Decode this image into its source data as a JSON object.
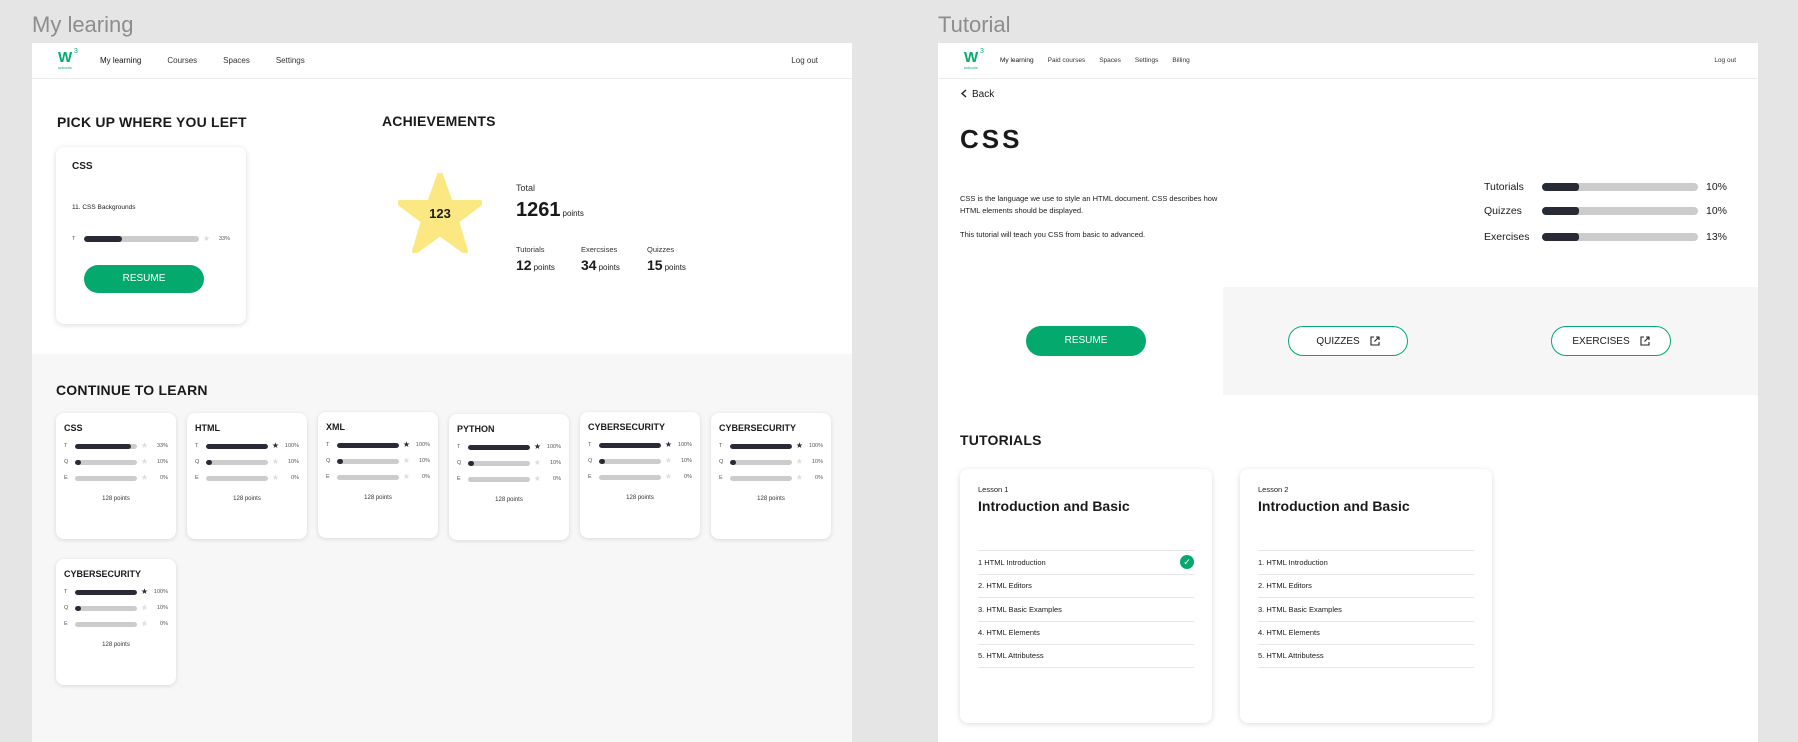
{
  "left": {
    "frame_label": "My learing",
    "nav": {
      "items": [
        "My learning",
        "Courses",
        "Spaces",
        "Settings"
      ],
      "logout": "Log out"
    },
    "pick_up": {
      "heading": "PICK UP WHERE YOU LEFT",
      "course": "CSS",
      "lesson": "11. CSS Backgrounds",
      "row_label": "T",
      "progress": 0.33,
      "percent": "33%",
      "resume": "RESUME"
    },
    "achievements": {
      "heading": "ACHIEVEMENTS",
      "star_value": "123",
      "total_label": "Total",
      "total_value": "1261",
      "points_word": "points",
      "tutorials_label": "Tutorials",
      "tutorials_value": "12",
      "exercises_label": "Exercsises",
      "exercises_value": "34",
      "quizzes_label": "Quizzes",
      "quizzes_value": "15"
    },
    "continue": {
      "heading": "CONTINUE TO LEARN",
      "cards": [
        {
          "title": "CSS",
          "rows": [
            {
              "l": "T",
              "p": 0.9,
              "s": false,
              "v": "33%"
            },
            {
              "l": "Q",
              "p": 0.1,
              "s": false,
              "v": "10%"
            },
            {
              "l": "E",
              "p": 0,
              "s": false,
              "v": "0%"
            }
          ],
          "points": "128 points"
        },
        {
          "title": "HTML",
          "rows": [
            {
              "l": "T",
              "p": 1,
              "s": true,
              "v": "100%"
            },
            {
              "l": "Q",
              "p": 0.1,
              "s": false,
              "v": "10%"
            },
            {
              "l": "E",
              "p": 0,
              "s": false,
              "v": "0%"
            }
          ],
          "points": "128 points"
        },
        {
          "title": "XML",
          "rows": [
            {
              "l": "T",
              "p": 1,
              "s": true,
              "v": "100%"
            },
            {
              "l": "Q",
              "p": 0.1,
              "s": false,
              "v": "10%"
            },
            {
              "l": "E",
              "p": 0,
              "s": false,
              "v": "0%"
            }
          ],
          "points": "128 points"
        },
        {
          "title": "PYTHON",
          "rows": [
            {
              "l": "T",
              "p": 1,
              "s": true,
              "v": "100%"
            },
            {
              "l": "Q",
              "p": 0.1,
              "s": false,
              "v": "10%"
            },
            {
              "l": "E",
              "p": 0,
              "s": false,
              "v": "0%"
            }
          ],
          "points": "128 points"
        },
        {
          "title": "CYBERSECURITY",
          "rows": [
            {
              "l": "T",
              "p": 1,
              "s": true,
              "v": "100%"
            },
            {
              "l": "Q",
              "p": 0.1,
              "s": false,
              "v": "10%"
            },
            {
              "l": "E",
              "p": 0,
              "s": false,
              "v": "0%"
            }
          ],
          "points": "128 points"
        },
        {
          "title": "CYBERSECURITY",
          "rows": [
            {
              "l": "T",
              "p": 1,
              "s": true,
              "v": "100%"
            },
            {
              "l": "Q",
              "p": 0.1,
              "s": false,
              "v": "10%"
            },
            {
              "l": "E",
              "p": 0,
              "s": false,
              "v": "0%"
            }
          ],
          "points": "128 points"
        },
        {
          "title": "CYBERSECURITY",
          "rows": [
            {
              "l": "T",
              "p": 1,
              "s": true,
              "v": "100%"
            },
            {
              "l": "Q",
              "p": 0.1,
              "s": false,
              "v": "10%"
            },
            {
              "l": "E",
              "p": 0,
              "s": false,
              "v": "0%"
            }
          ],
          "points": "128 points"
        }
      ]
    }
  },
  "right": {
    "frame_label": "Tutorial",
    "nav": {
      "items": [
        "My learning",
        "Paid courses",
        "Spaces",
        "Settings",
        "Billing"
      ],
      "logout": "Log out"
    },
    "back": "Back",
    "title": "CSS",
    "desc1": "CSS is the language we use to style an HTML document. CSS describes how HTML elements should be displayed.",
    "desc2": "This tutorial will teach you CSS from basic to advanced.",
    "stats": [
      {
        "label": "Tutorials",
        "progress": 0.24,
        "value": "10%"
      },
      {
        "label": "Quizzes",
        "progress": 0.24,
        "value": "10%"
      },
      {
        "label": "Exercises",
        "progress": 0.24,
        "value": "13%"
      }
    ],
    "buttons": {
      "resume": "RESUME",
      "quizzes": "QUIZZES",
      "exercises": "EXERCISES"
    },
    "tutorials_heading": "TUTORIALS",
    "lessons": [
      {
        "lesson": "Lesson 1",
        "title": "Introduction and Basic",
        "items": [
          "1 HTML Introduction",
          "2. HTML Editors",
          "3. HTML Basic Examples",
          "4. HTML Elements",
          "5. HTML Attributess"
        ],
        "done_first": true
      },
      {
        "lesson": "Lesson 2",
        "title": "Introduction and Basic",
        "items": [
          "1. HTML Introduction",
          "2. HTML Editors",
          "3. HTML Basic Examples",
          "4. HTML Elements",
          "5. HTML Attributess"
        ],
        "done_first": false
      }
    ]
  },
  "colors": {
    "accent": "#04aa6d",
    "dark": "#282a35",
    "star": "#fce883"
  },
  "icons": {
    "star": "star-icon",
    "back": "chevron-left-icon",
    "external": "external-link-icon",
    "check": "check-icon"
  }
}
